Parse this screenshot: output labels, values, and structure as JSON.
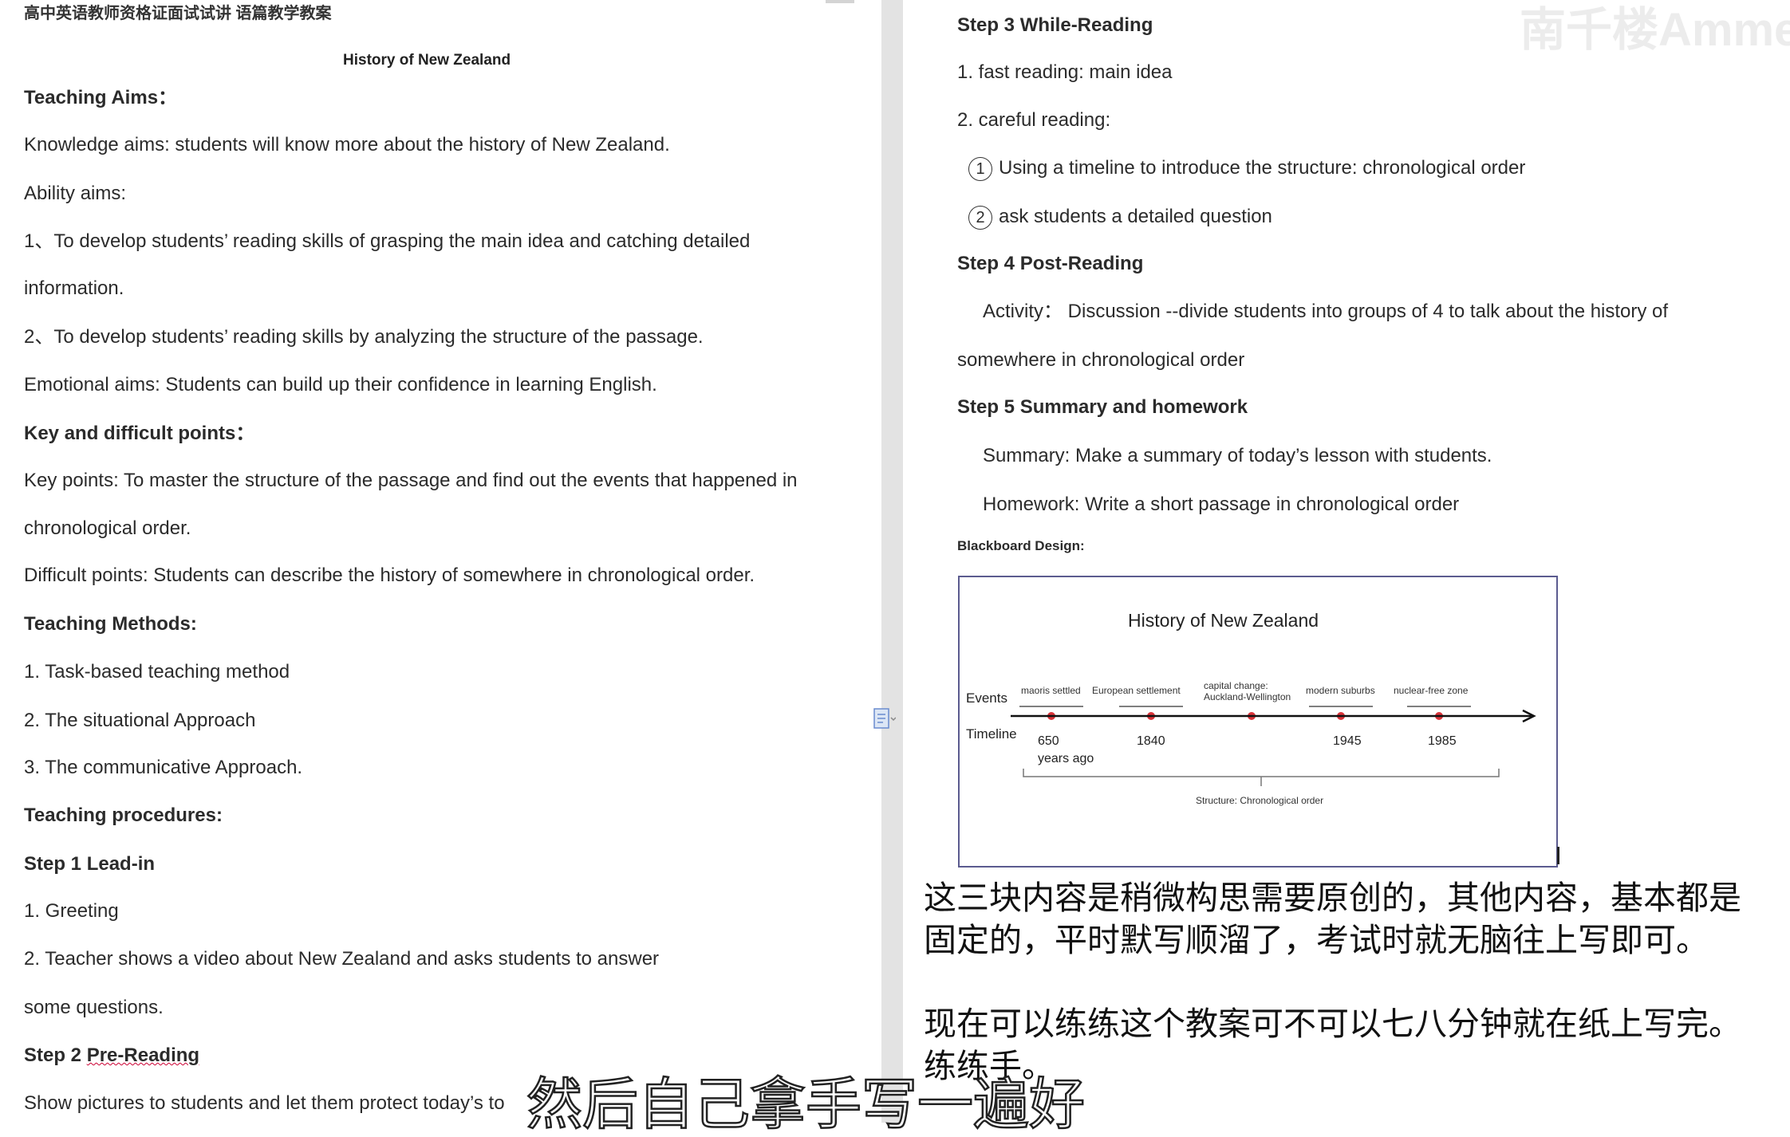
{
  "doc_header": "高中英语教师资格证面试试讲  语篇教学教案",
  "left": {
    "title": "History of New Zealand",
    "teaching_aims_heading": "Teaching Aims：",
    "knowledge_aims": "Knowledge aims: students will know more about the history of New Zealand.",
    "ability_aims": "Ability aims:",
    "ability_1a": "1、To develop students’ reading skills of grasping the main idea and catching detailed",
    "ability_1b": "information.",
    "ability_2": "2、To develop students’ reading skills by analyzing the structure of the passage.",
    "emotional_aims": "Emotional aims: Students can build up their confidence in learning English.",
    "key_points_heading": "Key and difficult points：",
    "key_points_a": "Key points: To master the structure of the passage and find out the events that happened in",
    "key_points_b": "chronological order.",
    "difficult_points": "Difficult points: Students can describe the history of somewhere in chronological order.",
    "methods_heading": "Teaching Methods:",
    "method_1": "1. Task-based teaching method",
    "method_2": "2. The situational Approach",
    "method_3": "3. The communicative Approach.",
    "procedures_heading": "Teaching procedures:",
    "step1_heading": "Step 1 Lead-in",
    "step1_1": "1. Greeting",
    "step1_2a": "2. Teacher shows a video about New Zealand and asks students to answer",
    "step1_2b": "some questions.",
    "step2_heading_a": "Step 2 ",
    "step2_heading_b": "Pre-Reading",
    "step2_text": "Show pictures to students and let them protect today’s to"
  },
  "right": {
    "step3_heading": "Step 3 While-Reading",
    "step3_1": "1. fast reading: main idea",
    "step3_2": "2. careful reading:",
    "step3_2_1_num": "1",
    "step3_2_1": "Using a timeline to introduce the structure: chronological order",
    "step3_2_2_num": "2",
    "step3_2_2": "ask students a detailed question",
    "step4_heading": "Step 4 Post-Reading",
    "step4_activity_a": "Activity：   Discussion --divide students into groups of 4 to talk about the history of",
    "step4_activity_b": "somewhere in chronological order",
    "step5_heading": "Step 5 Summary and homework",
    "summary": "Summary: Make a summary of today’s lesson with students.",
    "homework": "Homework: Write a short passage in chronological order",
    "blackboard_heading": "Blackboard Design:"
  },
  "blackboard": {
    "title": "History of  New Zealand",
    "events_label": "Events",
    "timeline_label": "Timeline",
    "events": [
      "maoris settled",
      "European settlement",
      "capital change:",
      "modern suburbs",
      "nuclear-free zone"
    ],
    "event_extra": "Auckland-Wellington",
    "dates": [
      "650",
      "1840",
      "",
      "1945",
      "1985"
    ],
    "date_extra": "years ago",
    "structure": "Structure: Chronological order",
    "dot_color": "#d9343a",
    "line_color": "#111111"
  },
  "captions": {
    "line1": "这三块内容是稍微构思需要原创的，其他内容，基本都是",
    "line2": "固定的，平时默写顺溜了，考试时就无脑往上写即可。",
    "line3": "现在可以练练这个教案可不可以七八分钟就在纸上写完。",
    "line4": "练练手。",
    "subtitle": "然后自己拿手写一遍好",
    "watermark": "南千楼Amme"
  }
}
